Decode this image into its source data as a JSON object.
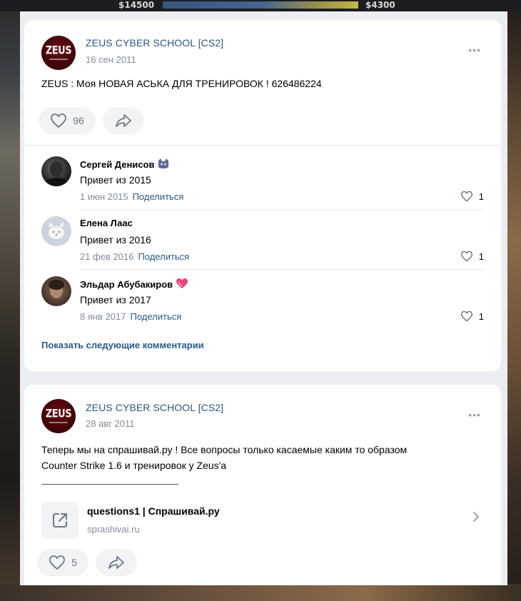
{
  "hud": {
    "money_left": "$14500",
    "money_right": "$4300"
  },
  "post1": {
    "author": "ZEUS CYBER SCHOOL [CS2]",
    "date": "16 сен 2011",
    "text": "ZEUS : Моя НОВАЯ АСЬКА ДЛЯ ТРЕНИРОВОК ! 626486224",
    "likes": "96",
    "more": "•••",
    "logo_text": "ZEUS",
    "comments": [
      {
        "name": "Сергей Денисов",
        "emoji": "cat-emoji",
        "text": "Привет из 2015",
        "date": "1 июн 2015",
        "share": "Поделиться",
        "likes": "1"
      },
      {
        "name": "Елена Лаас",
        "emoji": "",
        "text": "Привет из 2016",
        "date": "21 фев 2016",
        "share": "Поделиться",
        "likes": "1"
      },
      {
        "name": "Эльдар Абубакиров",
        "emoji": "heart-emoji",
        "text": "Привет из 2017",
        "date": "8 янв 2017",
        "share": "Поделиться",
        "likes": "1"
      }
    ],
    "show_more": "Показать следующие комментарии"
  },
  "post2": {
    "author": "ZEUS CYBER SCHOOL [CS2]",
    "date": "28 авг 2011",
    "text_line1": "Теперь мы на спрашивай.ру ! Все вопросы только касаемые каким то образом",
    "text_line2": "Counter Strike 1.6 и тренировок у Zeus'a",
    "more": "•••",
    "logo_text": "ZEUS",
    "link_title": "questions1 | Спрашивай.ру",
    "link_domain": "sprashivai.ru",
    "likes": "5"
  },
  "colors": {
    "link": "#2a5885",
    "secondary": "#818c99",
    "feed_bg": "#ebedf0"
  }
}
